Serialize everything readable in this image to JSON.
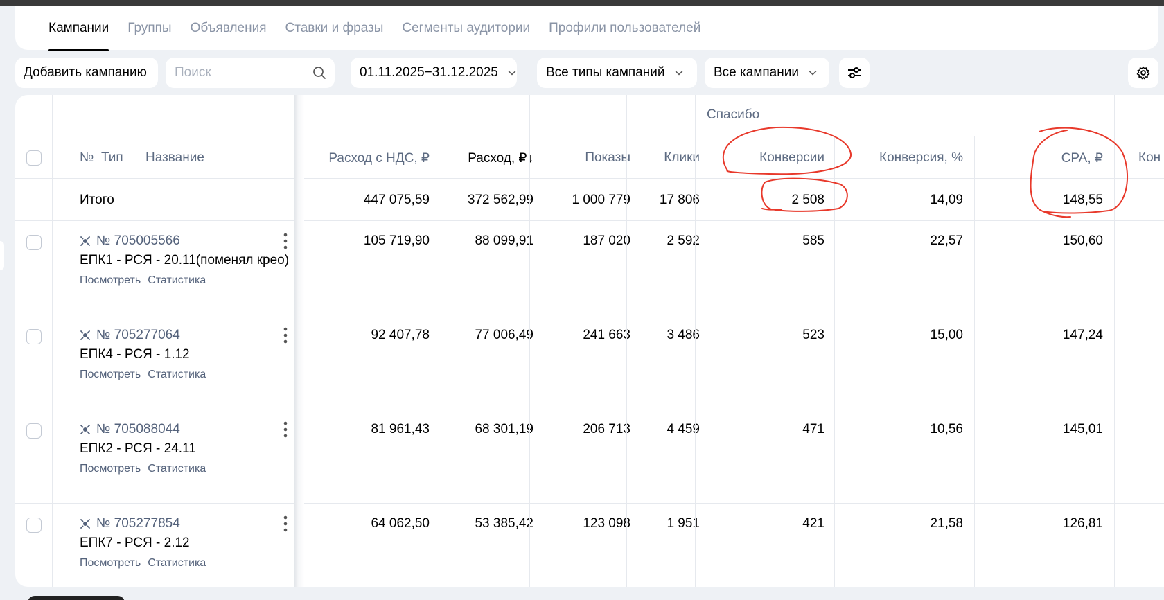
{
  "tabs": [
    {
      "label": "Кампании",
      "active": true
    },
    {
      "label": "Группы"
    },
    {
      "label": "Объявления"
    },
    {
      "label": "Ставки и фразы"
    },
    {
      "label": "Сегменты аудитории"
    },
    {
      "label": "Профили пользователей"
    }
  ],
  "toolbar": {
    "add_label": "Добавить кампанию",
    "search_placeholder": "Поиск",
    "date_range": "01.11.2025−31.12.2025",
    "campaign_types": "Все типы кампаний",
    "campaigns": "Все кампании"
  },
  "table": {
    "group_header": "Спасибо",
    "headers": {
      "num": "№",
      "type": "Тип",
      "name": "Название",
      "spend_vat": "Расход с НДС, ₽",
      "spend": "Расход, ₽↓",
      "impressions": "Показы",
      "clicks": "Клики",
      "conversions": "Конверсии",
      "conv_rate": "Конверсия, %",
      "cpa": "CPA, ₽",
      "partial": "Кон"
    },
    "total": {
      "label": "Итого",
      "spend_vat": "447 075,59",
      "spend": "372 562,99",
      "impressions": "1 000 779",
      "clicks": "17 806",
      "conversions": "2 508",
      "conv_rate": "14,09",
      "cpa": "148,55"
    },
    "link_view": "Посмотреть",
    "link_stats": "Статистика",
    "rows": [
      {
        "num": "№ 705005566",
        "name": "ЕПК1 - РСЯ - 20.11(поменял крео)",
        "spend_vat": "105 719,90",
        "spend": "88 099,91",
        "impressions": "187 020",
        "clicks": "2 592",
        "conversions": "585",
        "conv_rate": "22,57",
        "cpa": "150,60"
      },
      {
        "num": "№ 705277064",
        "name": "ЕПК4 - РСЯ - 1.12",
        "spend_vat": "92 407,78",
        "spend": "77 006,49",
        "impressions": "241 663",
        "clicks": "3 486",
        "conversions": "523",
        "conv_rate": "15,00",
        "cpa": "147,24"
      },
      {
        "num": "№ 705088044",
        "name": "ЕПК2 - РСЯ - 24.11",
        "spend_vat": "81 961,43",
        "spend": "68 301,19",
        "impressions": "206 713",
        "clicks": "4 459",
        "conversions": "471",
        "conv_rate": "10,56",
        "cpa": "145,01"
      },
      {
        "num": "№ 705277854",
        "name": "ЕПК7 - РСЯ - 2.12",
        "spend_vat": "64 062,50",
        "spend": "53 385,42",
        "impressions": "123 098",
        "clicks": "1 951",
        "conversions": "421",
        "conv_rate": "21,58",
        "cpa": "126,81"
      }
    ]
  },
  "colors": {
    "annotation": "#e8392b",
    "muted": "#8a94a6",
    "link": "#54627b"
  }
}
